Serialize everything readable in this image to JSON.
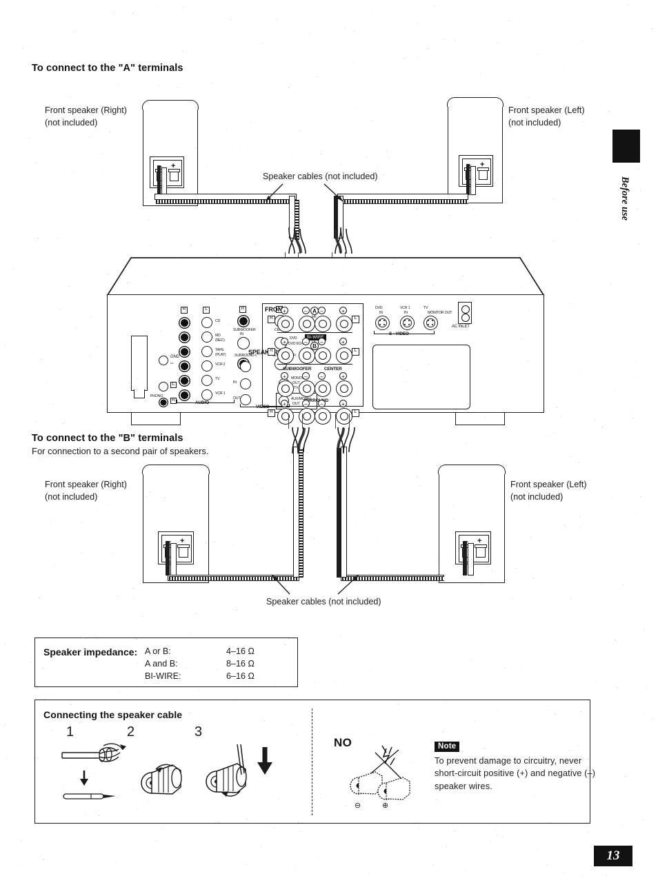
{
  "page": {
    "number": "13",
    "side_tab_label": "Before use"
  },
  "section_a": {
    "heading": "To connect to the \"A\" terminals",
    "speaker_right": {
      "line1": "Front speaker (Right)",
      "line2": "(not included)"
    },
    "speaker_left": {
      "line1": "Front speaker (Left)",
      "line2": "(not included)"
    },
    "cable_caption": "Speaker cables (not included)"
  },
  "section_b": {
    "heading": "To connect to the \"B\" terminals",
    "subheading": "For connection to a second pair of speakers.",
    "speaker_right": {
      "line1": "Front speaker (Right)",
      "line2": "(not included)"
    },
    "speaker_left": {
      "line1": "Front speaker (Left)",
      "line2": "(not included)"
    },
    "cable_caption": "Speaker cables (not included)"
  },
  "speaker_terminal": {
    "minus": "–",
    "plus": "+"
  },
  "amplifier": {
    "speakers_label": "SPEAKERS",
    "front_label": "FRONT",
    "bi_wire_label": "BI-WIRE",
    "group_a": "A",
    "group_b": "B",
    "lf_label": "LF",
    "hf_label": "HF",
    "subwoofer_label": "SUBWOOFER",
    "center_label": "CENTER",
    "surround_label": "SURROUND",
    "right_label": "R",
    "left_label": "L",
    "plus": "+",
    "minus": "–",
    "ac_inlet_label": "AC INLET",
    "s_video_label": "S - VIDEO",
    "audio_label": "AUDIO",
    "video_label": "VIDEO",
    "phono_label": "PHONO",
    "gnd_label": "GND",
    "s_video_jacks": [
      {
        "name": "DVD",
        "sub": "IN"
      },
      {
        "name": "VCR 1",
        "sub": "IN"
      },
      {
        "name": "TV",
        "sub": "MONITOR OUT"
      }
    ],
    "audio_rows": [
      {
        "label": "CD",
        "sub": ""
      },
      {
        "label": "MD",
        "sub": "(REC)"
      },
      {
        "label": "TAPE",
        "sub": "(PLAY)"
      },
      {
        "label": "VCR 2",
        "sub": ""
      },
      {
        "label": "TV",
        "sub": ""
      },
      {
        "label": "VCR 1",
        "sub": ""
      }
    ],
    "center_column": [
      {
        "label": "SUBWOOFER",
        "sub": "IN"
      },
      {
        "label": "CENTER",
        "sub": ""
      },
      {
        "label": "SURROUND",
        "sub": "L/R"
      },
      {
        "label": "DVD",
        "sub": "DVD 6CH"
      }
    ],
    "video_labels": [
      {
        "label": "IN",
        "sub": ""
      },
      {
        "label": "OUT",
        "sub": ""
      },
      {
        "label": "MONITOR",
        "sub": "OUT  TV"
      },
      {
        "label": "AUX/MODEL",
        "sub": "OUT"
      }
    ],
    "channel_tags": {
      "r": "R",
      "l": "L"
    }
  },
  "impedance": {
    "title": "Speaker impedance:",
    "rows": [
      {
        "mode": "A or B:",
        "value": "4–16 Ω"
      },
      {
        "mode": "A and B:",
        "value": "8–16 Ω"
      },
      {
        "mode": "BI-WIRE:",
        "value": "6–16 Ω"
      }
    ]
  },
  "cable_howto": {
    "title": "Connecting the speaker cable",
    "steps": [
      "1",
      "2",
      "3"
    ],
    "no_label": "NO",
    "note_tag": "Note",
    "note_text": "To prevent damage to circuitry, never short-circuit positive (+) and negative (–) speaker wires.",
    "polarity_minus": "–",
    "polarity_plus": "+"
  }
}
